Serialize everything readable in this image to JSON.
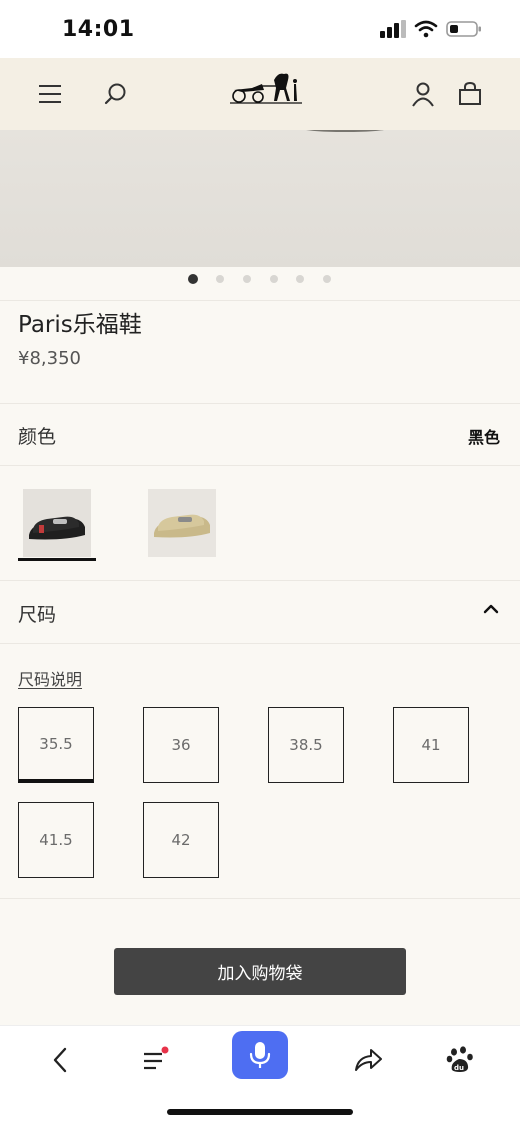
{
  "status_bar": {
    "time": "14:01"
  },
  "header": {
    "logo_name": "hermes-carriage-logo"
  },
  "carousel": {
    "count": 6,
    "active_index": 0
  },
  "product": {
    "title": "Paris乐福鞋",
    "price": "¥8,350"
  },
  "color_section": {
    "label": "颜色",
    "value": "黑色",
    "options": [
      {
        "name": "black-loafer",
        "selected": true
      },
      {
        "name": "beige-loafer",
        "selected": false
      }
    ]
  },
  "size_section": {
    "label": "尺码",
    "guide_link": "尺码说明",
    "sizes": [
      "35.5",
      "36",
      "38.5",
      "41",
      "41.5",
      "42"
    ],
    "selected": "35.5"
  },
  "actions": {
    "add_to_bag": "加入购物袋"
  },
  "colors": {
    "accent_blue": "#4e6ef2",
    "button_dark": "#444444",
    "notify_red": "#e8334a"
  }
}
